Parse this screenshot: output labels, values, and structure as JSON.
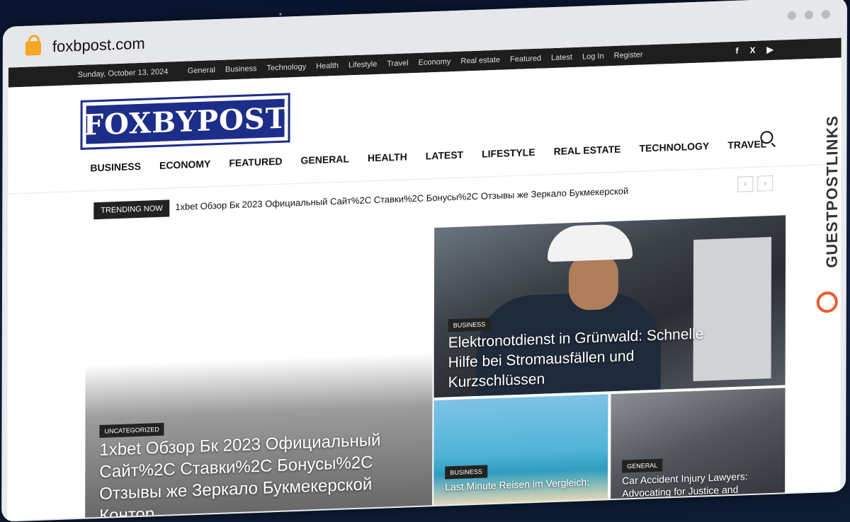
{
  "browser": {
    "url": "foxbpost.com"
  },
  "topbar": {
    "date": "Sunday, October 13, 2024",
    "links": [
      "General",
      "Business",
      "Technology",
      "Health",
      "Lifestyle",
      "Travel",
      "Economy",
      "Real estate",
      "Featured",
      "Latest",
      "Log In",
      "Register"
    ],
    "social": [
      "f",
      "X",
      "▶"
    ]
  },
  "logo": {
    "text": "FOXBYPOST"
  },
  "nav": {
    "items": [
      "BUSINESS",
      "ECONOMY",
      "FEATURED",
      "GENERAL",
      "HEALTH",
      "LATEST",
      "LIFESTYLE",
      "REAL ESTATE",
      "TECHNOLOGY",
      "TRAVEL"
    ]
  },
  "trending": {
    "label": "TRENDING NOW",
    "headline": "1xbet Обзор Бк 2023 Официальный Сайт%2C Ставки%2C Бонусы%2C Отзывы же Зеркало Букмекерской"
  },
  "articles": [
    {
      "category": "UNCATEGORIZED",
      "title": "1xbet Обзор Бк 2023 Официальный Сайт%2C Ставки%2C Бонусы%2C Отзывы же Зеркало Букмекерской Контор"
    },
    {
      "category": "BUSINESS",
      "title": "Elektronotdienst in Grünwald: Schnelle Hilfe bei Stromausfällen und Kurzschlüssen"
    },
    {
      "category": "BUSINESS",
      "title": "Last Minute Reisen im Vergleich:"
    },
    {
      "category": "GENERAL",
      "title": "Car Accident Injury Lawyers: Advocating for Justice and"
    }
  ],
  "watermark": {
    "text": "GUESTPOSTLINKS"
  }
}
